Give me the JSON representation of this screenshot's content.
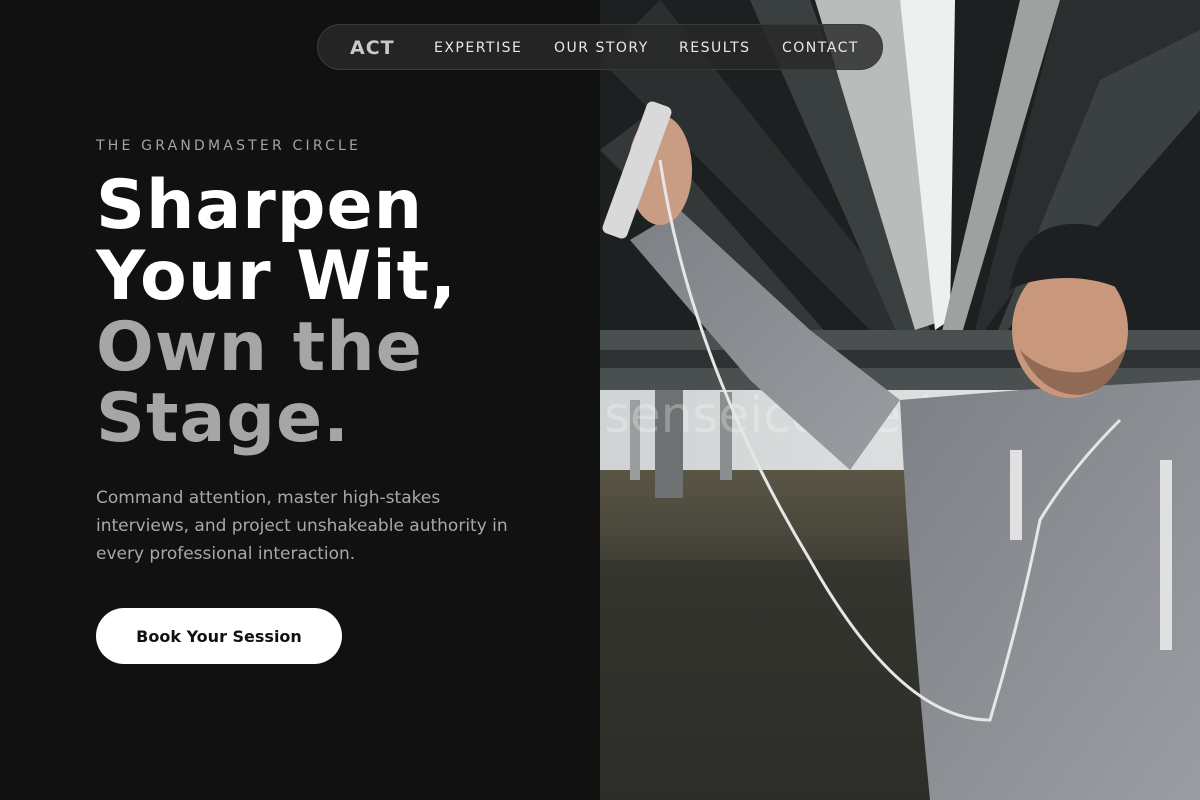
{
  "nav": {
    "logo": "ACT",
    "links": [
      "EXPERTISE",
      "OUR STORY",
      "RESULTS",
      "CONTACT"
    ]
  },
  "hero": {
    "eyebrow": "THE GRANDMASTER CIRCLE",
    "headline_lines": [
      "Sharpen",
      "Your Wit,",
      "Own the",
      "Stage."
    ],
    "description": "Command attention, master high-stakes interviews, and project unshakeable authority in every professional interaction.",
    "cta_label": "Book Your Session"
  },
  "photo": {
    "watermark": "senseicomedy.com"
  },
  "colors": {
    "background": "#111111",
    "accent_muted": "#a6a6a6",
    "cta_bg": "#ffffff"
  }
}
